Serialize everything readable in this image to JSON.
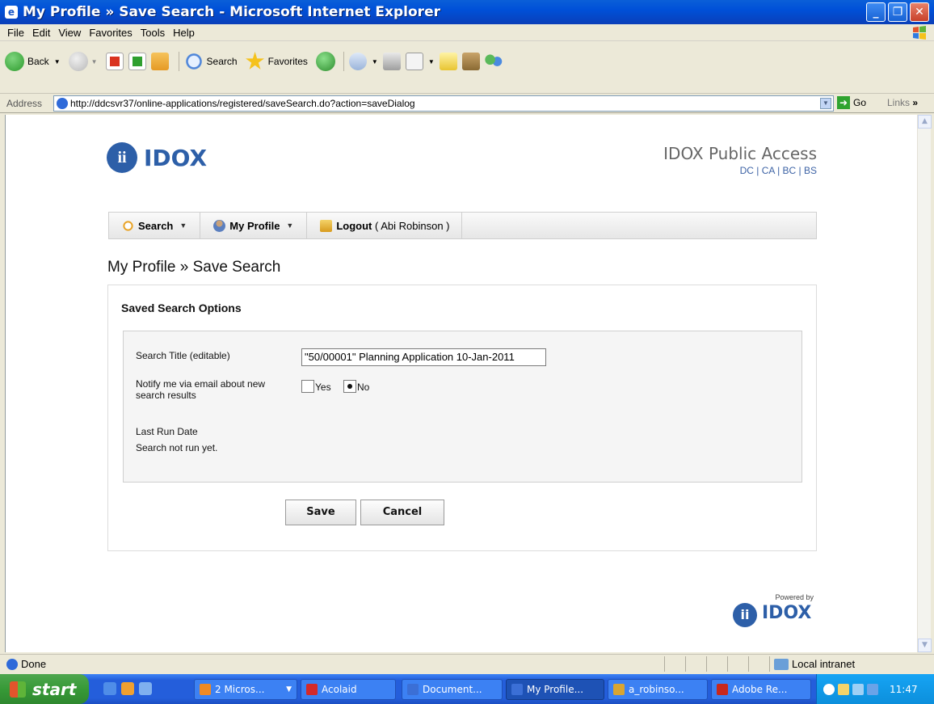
{
  "window": {
    "title": "My Profile » Save Search - Microsoft Internet Explorer"
  },
  "menu": [
    "File",
    "Edit",
    "View",
    "Favorites",
    "Tools",
    "Help"
  ],
  "toolbar": {
    "back": "Back",
    "search": "Search",
    "favorites": "Favorites"
  },
  "address": {
    "label": "Address",
    "url": "http://ddcsvr37/online-applications/registered/saveSearch.do?action=saveDialog",
    "go": "Go",
    "links": "Links"
  },
  "page": {
    "logo_text": "IDOX",
    "brand_title": "IDOX Public Access",
    "brand_sub": "DC | CA | BC | BS",
    "nav": {
      "search": "Search",
      "my_profile": "My Profile",
      "logout": "Logout",
      "user": "( Abi Robinson )"
    },
    "heading": "My Profile » Save Search",
    "box_title": "Saved Search Options",
    "search_title_label": "Search Title (editable)",
    "search_title_value": "\"50/00001\" Planning Application 10-Jan-2011",
    "notify_label_1": "Notify me via email about new",
    "notify_label_2": "search results",
    "notify_yes": "Yes",
    "notify_no": "No",
    "notify_selected": "No",
    "last_run_label": "Last Run Date",
    "last_run_value": "Search not run yet.",
    "save_button": "Save",
    "cancel_button": "Cancel",
    "powered_by": "Powered by",
    "powered_logo": "IDOX"
  },
  "status": {
    "left": "Done",
    "zone": "Local intranet"
  },
  "taskbar": {
    "start": "start",
    "tasks": [
      {
        "label": "2 Micros...",
        "color": "#f08a24"
      },
      {
        "label": "Acolaid",
        "color": "#d42a2a"
      },
      {
        "label": "Document...",
        "color": "#3b6fd6"
      },
      {
        "label": "My Profile...",
        "color": "#3b6fd6"
      },
      {
        "label": "a_robinso...",
        "color": "#d9a531"
      },
      {
        "label": "Adobe Re...",
        "color": "#c8281c"
      }
    ],
    "clock": "11:47"
  }
}
